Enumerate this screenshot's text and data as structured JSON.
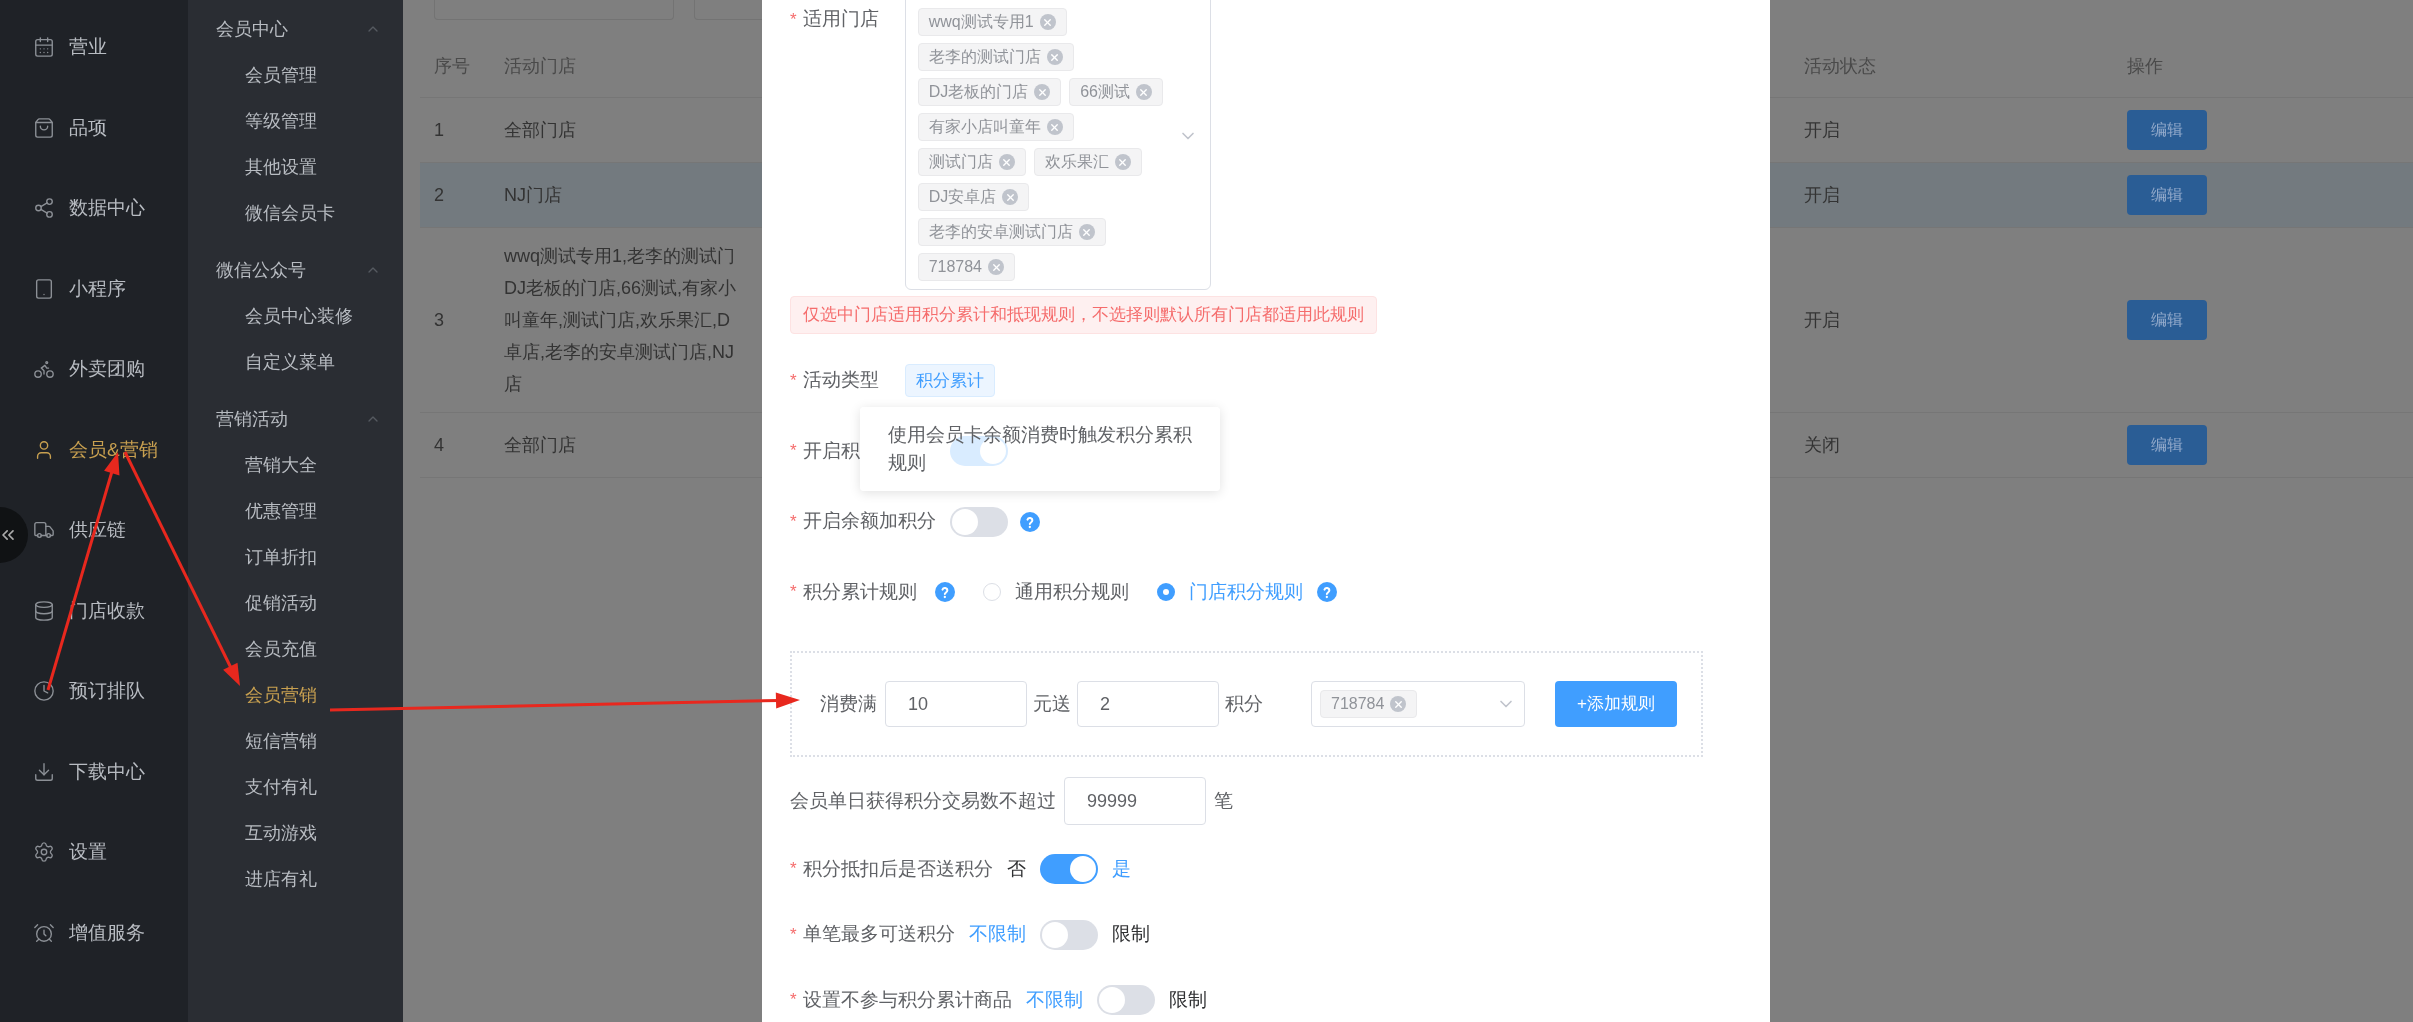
{
  "sidebar": {
    "items": [
      {
        "label": "营业",
        "selected": false
      },
      {
        "label": "品项",
        "selected": false
      },
      {
        "label": "数据中心",
        "selected": false
      },
      {
        "label": "小程序",
        "selected": false
      },
      {
        "label": "外卖团购",
        "selected": false
      },
      {
        "label": "会员&营销",
        "selected": true
      },
      {
        "label": "供应链",
        "selected": false
      },
      {
        "label": "门店收款",
        "selected": false
      },
      {
        "label": "预订排队",
        "selected": false
      },
      {
        "label": "下载中心",
        "selected": false
      },
      {
        "label": "设置",
        "selected": false
      },
      {
        "label": "增值服务",
        "selected": false
      }
    ]
  },
  "submenu": {
    "groups": [
      {
        "title": "会员中心",
        "expanded": true,
        "items": [
          {
            "label": "会员管理",
            "selected": false
          },
          {
            "label": "等级管理",
            "selected": false
          },
          {
            "label": "其他设置",
            "selected": false
          },
          {
            "label": "微信会员卡",
            "selected": false
          }
        ]
      },
      {
        "title": "微信公众号",
        "expanded": true,
        "items": [
          {
            "label": "会员中心装修",
            "selected": false
          },
          {
            "label": "自定义菜单",
            "selected": false
          }
        ]
      },
      {
        "title": "营销活动",
        "expanded": true,
        "items": [
          {
            "label": "营销大全",
            "selected": false
          },
          {
            "label": "优惠管理",
            "selected": false
          },
          {
            "label": "订单折扣",
            "selected": false
          },
          {
            "label": "促销活动",
            "selected": false
          },
          {
            "label": "会员充值",
            "selected": false
          },
          {
            "label": "会员营销",
            "selected": true
          },
          {
            "label": "短信营销",
            "selected": false
          },
          {
            "label": "支付有礼",
            "selected": false
          },
          {
            "label": "互动游戏",
            "selected": false
          },
          {
            "label": "进店有礼",
            "selected": false
          }
        ]
      }
    ]
  },
  "table": {
    "columns": [
      "序号",
      "活动门店",
      "活动状态",
      "操作"
    ],
    "rows": [
      {
        "index": "1",
        "stores": [
          "全部门店"
        ],
        "status": "开启",
        "action": "编辑",
        "hovered": false
      },
      {
        "index": "2",
        "stores": [
          "NJ门店"
        ],
        "status": "开启",
        "action": "编辑",
        "hovered": true
      },
      {
        "index": "3",
        "stores": [
          "wwq测试专用1,老李的测试门",
          "DJ老板的门店,66测试,有家小",
          "叫童年,测试门店,欢乐果汇,D",
          "卓店,老李的安卓测试门店,NJ",
          "店"
        ],
        "status": "开启",
        "action": "编辑",
        "hovered": false
      },
      {
        "index": "4",
        "stores": [
          "全部门店"
        ],
        "status": "关闭",
        "action": "编辑",
        "hovered": false
      }
    ]
  },
  "dialog": {
    "fields": [
      {
        "kind": "stores",
        "label": "适用门店",
        "required_mark": "*",
        "tags": [
          "wwq测试专用1",
          "老李的测试门店",
          "DJ老板的门店",
          "66测试",
          "有家小店叫童年",
          "测试门店",
          "欢乐果汇",
          "DJ安卓店",
          "老李的安卓测试门店",
          "718784"
        ]
      },
      {
        "kind": "notice",
        "text": "仅选中门店适用积分累计和抵现规则，不选择则默认所有门店都适用此规则"
      },
      {
        "kind": "tag",
        "label": "活动类型",
        "required_mark": "*",
        "value": "积分累计"
      },
      {
        "kind": "switch",
        "label": "开启积",
        "required_mark": "*",
        "on": true,
        "tooltip": "使用会员卡余额消费时触发积分累积规则"
      },
      {
        "kind": "switch",
        "label": "开启余额加积分",
        "required_mark": "*",
        "on": false,
        "help": true
      },
      {
        "kind": "radio",
        "label": "积分累计规则",
        "required_mark": "*",
        "help": true,
        "options": [
          {
            "label": "通用积分规则",
            "selected": false
          },
          {
            "label": "门店积分规则",
            "selected": true,
            "help": true
          }
        ]
      },
      {
        "kind": "rule",
        "prefix": "消费满",
        "amount": "10",
        "middle": "元送",
        "points": "2",
        "suffix": "积分",
        "store_tags": [
          "718784"
        ],
        "button": "+添加规则"
      },
      {
        "kind": "limit",
        "label": "会员单日获得积分交易数不超过",
        "value": "99999",
        "unit": "笔"
      },
      {
        "kind": "choice",
        "label": "积分抵扣后是否送积分",
        "required_mark": "*",
        "off_label": "否",
        "on_label": "是",
        "on": true
      },
      {
        "kind": "choice",
        "label": "单笔最多可送积分",
        "required_mark": "*",
        "off_label": "不限制",
        "on_label": "限制",
        "on": false
      },
      {
        "kind": "choice",
        "label": "设置不参与积分累计商品",
        "required_mark": "*",
        "off_label": "不限制",
        "on_label": "限制",
        "on": false
      }
    ]
  }
}
